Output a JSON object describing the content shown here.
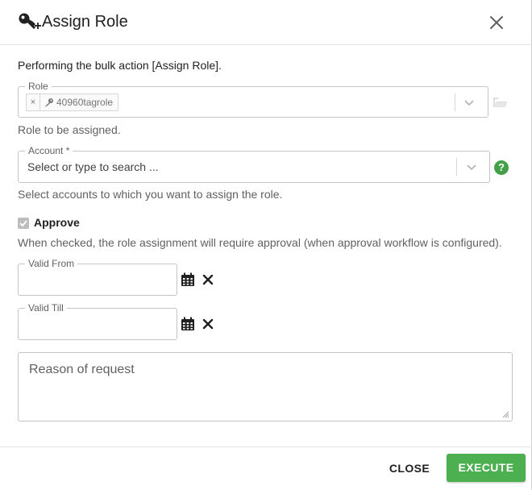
{
  "dialog": {
    "title": "Assign Role",
    "title_icon": "key-plus-icon",
    "close_icon": "close-icon"
  },
  "intro": "Performing the bulk action [Assign Role].",
  "role": {
    "legend": "Role",
    "chip_remove": "×",
    "chip_icon": "key-icon",
    "chip_label": "40960tagrole",
    "helper": "Role to be assigned.",
    "browse_icon": "folder-icon"
  },
  "account": {
    "legend": "Account *",
    "placeholder": "Select or type to search ...",
    "helper": "Select accounts to which you want to assign the role.",
    "help_icon": "?"
  },
  "approve": {
    "label": "Approve",
    "checked": true,
    "helper": "When checked, the role assignment will require approval (when approval workflow is configured)."
  },
  "valid_from": {
    "legend": "Valid From",
    "value": ""
  },
  "valid_till": {
    "legend": "Valid Till",
    "value": ""
  },
  "reason": {
    "placeholder": "Reason of request"
  },
  "footer": {
    "close_label": "CLOSE",
    "execute_label": "EXECUTE"
  },
  "colors": {
    "accent": "#4caf50",
    "help": "#43a047",
    "border": "#c4c4c4"
  }
}
